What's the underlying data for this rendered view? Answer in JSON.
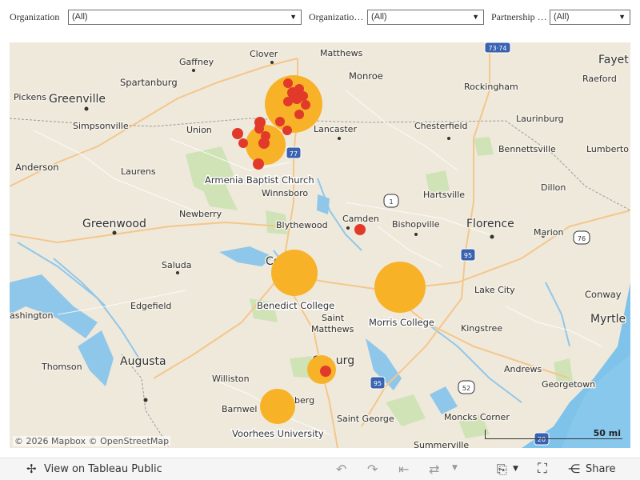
{
  "filters": [
    {
      "label": "Organization",
      "value": "(All)"
    },
    {
      "label": "Organizatio…",
      "value": "(All)"
    },
    {
      "label": "Partnership …",
      "value": "(All)"
    }
  ],
  "map": {
    "attribution": "© 2026 Mapbox © OpenStreetMap",
    "scale_label": "50 mi",
    "mark_colors": {
      "large": "#f8b228",
      "small": "#e1392a"
    },
    "mark_labels": {
      "armenia": "Armenia Baptist Church",
      "benedict": "Benedict College",
      "morris": "Morris College",
      "voorhees": "Voorhees University"
    },
    "cities": {
      "fayet": "Fayet",
      "gaffney": "Gaffney",
      "clover": "Clover",
      "matthews": "Matthews",
      "monroe": "Monroe",
      "spartanburg": "Spartanburg",
      "rockingham": "Rockingham",
      "raeford": "Raeford",
      "pickens": "Pickens",
      "greenville": "Greenville",
      "simpsonville": "Simpsonville",
      "union": "Union",
      "lancaster": "Lancaster",
      "chesterfield": "Chesterfield",
      "laurinburg": "Laurinburg",
      "bennettsville": "Bennettsville",
      "lumberton": "Lumberto",
      "anderson": "Anderson",
      "laurens": "Laurens",
      "winnsboro": "Winnsboro",
      "hartsville": "Hartsville",
      "dillon": "Dillon",
      "newberry": "Newberry",
      "camden": "Camden",
      "bishopville": "Bishopville",
      "blythewood": "Blythewood",
      "greenwood": "Greenwood",
      "florence": "Florence",
      "marion": "Marion",
      "saluda": "Saluda",
      "columbia": "Co         a",
      "edgefield": "Edgefield",
      "lake_city": "Lake City",
      "conway": "Conway",
      "washington": "ashington",
      "st_matthews_1": "Saint",
      "st_matthews_2": "Matthews",
      "kingstree": "Kingstree",
      "myrtle": "Myrtle",
      "thomson": "Thomson",
      "augusta": "Augusta",
      "orangeburg": "Ora         urg",
      "andrews": "Andrews",
      "williston": "Williston",
      "georgetown": "Georgetown",
      "barnwell": "Barnwel",
      "bamberg": "berg",
      "saint_george": "Saint George",
      "moncks_corner": "Moncks Corner",
      "summerville": "Summerville"
    },
    "shields": [
      "73·74",
      "77",
      "1",
      "76",
      "95",
      "95",
      "52",
      "20"
    ]
  },
  "toolbar": {
    "view_label": "View on Tableau Public",
    "share_label": "Share"
  }
}
